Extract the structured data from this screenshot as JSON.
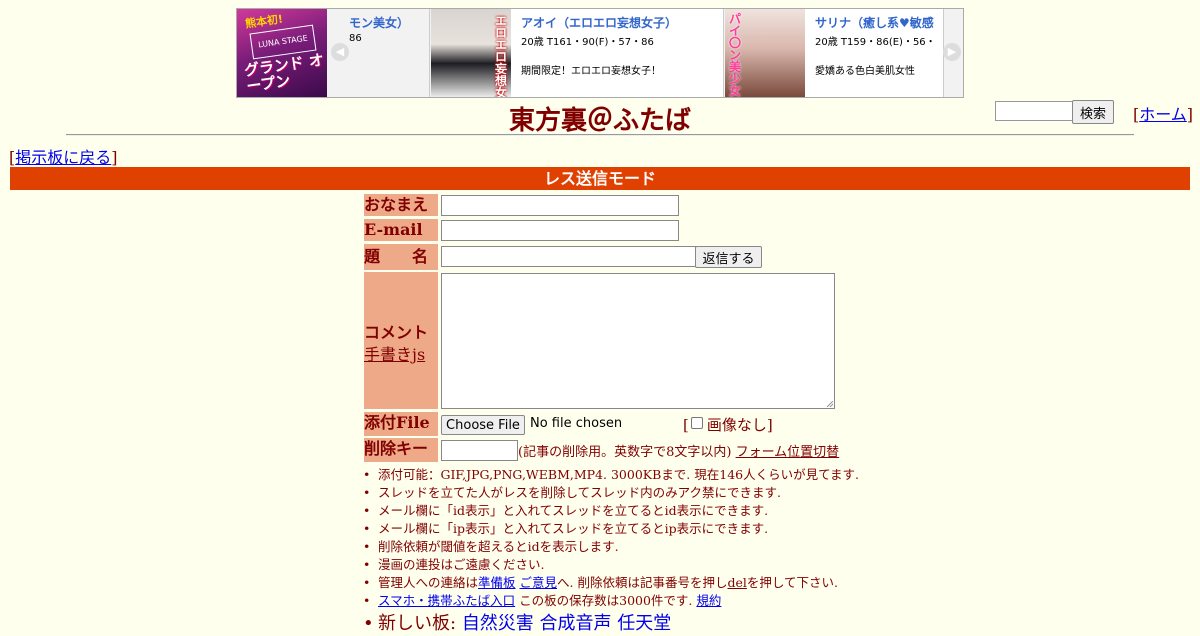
{
  "banner": {
    "logo": {
      "line1": "熊本初!",
      "line2": "LUNA STAGE",
      "line3": "グランド オープン"
    },
    "partial": {
      "name": "モン美女）",
      "stat": "86"
    },
    "ads": [
      {
        "name": "アオイ（エロエロ妄想女子）",
        "stat": "20歳 T161・90(F)・57・86",
        "desc": "期間限定！エロエロ妄想女子！",
        "photo_tag": "エロエロ妄想女子"
      },
      {
        "name": "サリナ（癒し系♥敏感",
        "stat": "20歳 T159・86(E)・56・",
        "desc": "愛嬌ある色白美肌女性",
        "photo_tag": "パイ〇ン美少女♥"
      }
    ]
  },
  "header": {
    "title": "東方裏＠ふたば",
    "search_button": "検索",
    "home_link": "ホーム",
    "back_link": "掲示板に戻る"
  },
  "mode_bar": "レス送信モード",
  "form": {
    "name_label": "おなまえ",
    "email_label": "E-mail",
    "subject_label": "題　　名",
    "submit_button": "返信する",
    "comment_label": "コメント",
    "handwrite_link": "手書きjs",
    "file_label": "添付File",
    "file_button": "Choose File",
    "no_file_text": "No file chosen",
    "no_image_label": "画像なし",
    "delkey_label": "削除キー",
    "delkey_note": "(記事の削除用。英数字で8文字以内)",
    "form_toggle_link": "フォーム位置切替"
  },
  "notes": {
    "n1": "添付可能：GIF,JPG,PNG,WEBM,MP4. 3000KBまで. 現在146人くらいが見てます.",
    "n2": "スレッドを立てた人がレスを削除してスレッド内のみアク禁にできます.",
    "n3": "メール欄に「id表示」と入れてスレッドを立てるとid表示にできます.",
    "n4": "メール欄に「ip表示」と入れてスレッドを立てるとip表示にできます.",
    "n5": "削除依頼が閾値を超えるとidを表示します.",
    "n6": "漫画の連投はご遠慮ください.",
    "n7_pre": "管理人への連絡は",
    "n7_link1": "準備板",
    "n7_link2": "ご意見",
    "n7_mid": "へ. 削除依頼は記事番号を押し",
    "n7_del": "del",
    "n7_post": "を押して下さい.",
    "n8_link": "スマホ・携帯ふたば入口",
    "n8_mid": "この板の保存数は3000件です.",
    "n8_terms": "規約",
    "n9_label": "新しい板:",
    "new_boards": [
      "自然災害",
      "合成音声",
      "任天堂"
    ]
  },
  "colors": {
    "background": "#ffffee",
    "text": "#800000",
    "mode_bar": "#e04000",
    "label_bg": "#eeaa88",
    "link": "#0000ee"
  }
}
